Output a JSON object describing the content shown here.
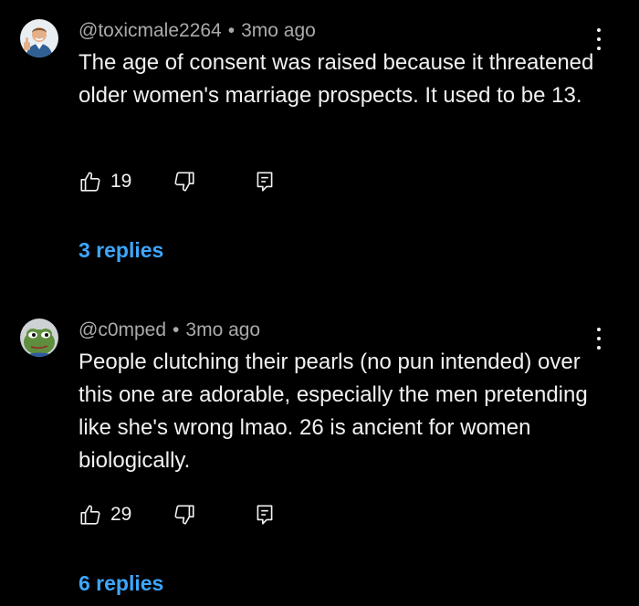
{
  "comments": [
    {
      "author": "@toxicmale2264",
      "separator": "•",
      "time": "3mo ago",
      "text": "The age of consent was raised because it threatened older women's marriage prospects. It used to be 13.",
      "likes": "19",
      "replies_label": "3 replies",
      "avatar_icon": "man-thumbs-up-avatar"
    },
    {
      "author": "@c0mped",
      "separator": "•",
      "time": "3mo ago",
      "text": "People clutching their pearls (no pun intended) over this one are adorable, especially the men pretending like she's wrong lmao. 26 is ancient for women biologically.",
      "likes": "29",
      "replies_label": "6 replies",
      "avatar_icon": "pepe-frog-avatar"
    }
  ],
  "colors": {
    "background": "#000000",
    "text": "#f1f1f1",
    "meta": "#aaaaaa",
    "link": "#3ea6ff"
  }
}
